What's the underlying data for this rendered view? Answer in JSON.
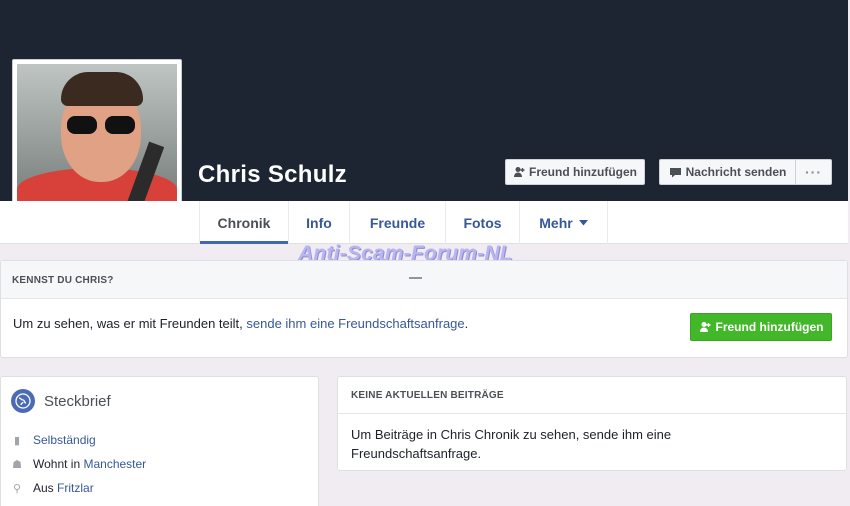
{
  "profile": {
    "name": "Chris Schulz"
  },
  "cover_actions": {
    "add_friend_label": "Freund hinzufügen",
    "message_label": "Nachricht senden",
    "more_label": "···"
  },
  "tabs": [
    {
      "label": "Chronik"
    },
    {
      "label": "Info"
    },
    {
      "label": "Freunde"
    },
    {
      "label": "Fotos"
    },
    {
      "label": "Mehr"
    }
  ],
  "watermark": "Anti-Scam-Forum-NL",
  "know_card": {
    "title": "KENNST DU CHRIS?",
    "text": "Um zu sehen, was er mit Freunden teilt,",
    "link": "sende ihm eine Freundschaftsanfrage",
    "text_end": ".",
    "button_label": "Freund hinzufügen"
  },
  "intro": {
    "title": "Steckbrief",
    "job": "Selbständig",
    "lives_prefix": "Wohnt in",
    "lives_city": "Manchester",
    "from_prefix": "Aus",
    "from_city": "Fritzlar"
  },
  "posts": {
    "title": "KEINE AKTUELLEN BEITRÄGE",
    "text": "Um Beiträge in Chris Chronik zu sehen, sende ihm eine Freundschaftsanfrage."
  },
  "colors": {
    "cover": "#1d2532",
    "link": "#365899",
    "green_button": "#42b72a",
    "active_tab_underline": "#4267b2"
  }
}
